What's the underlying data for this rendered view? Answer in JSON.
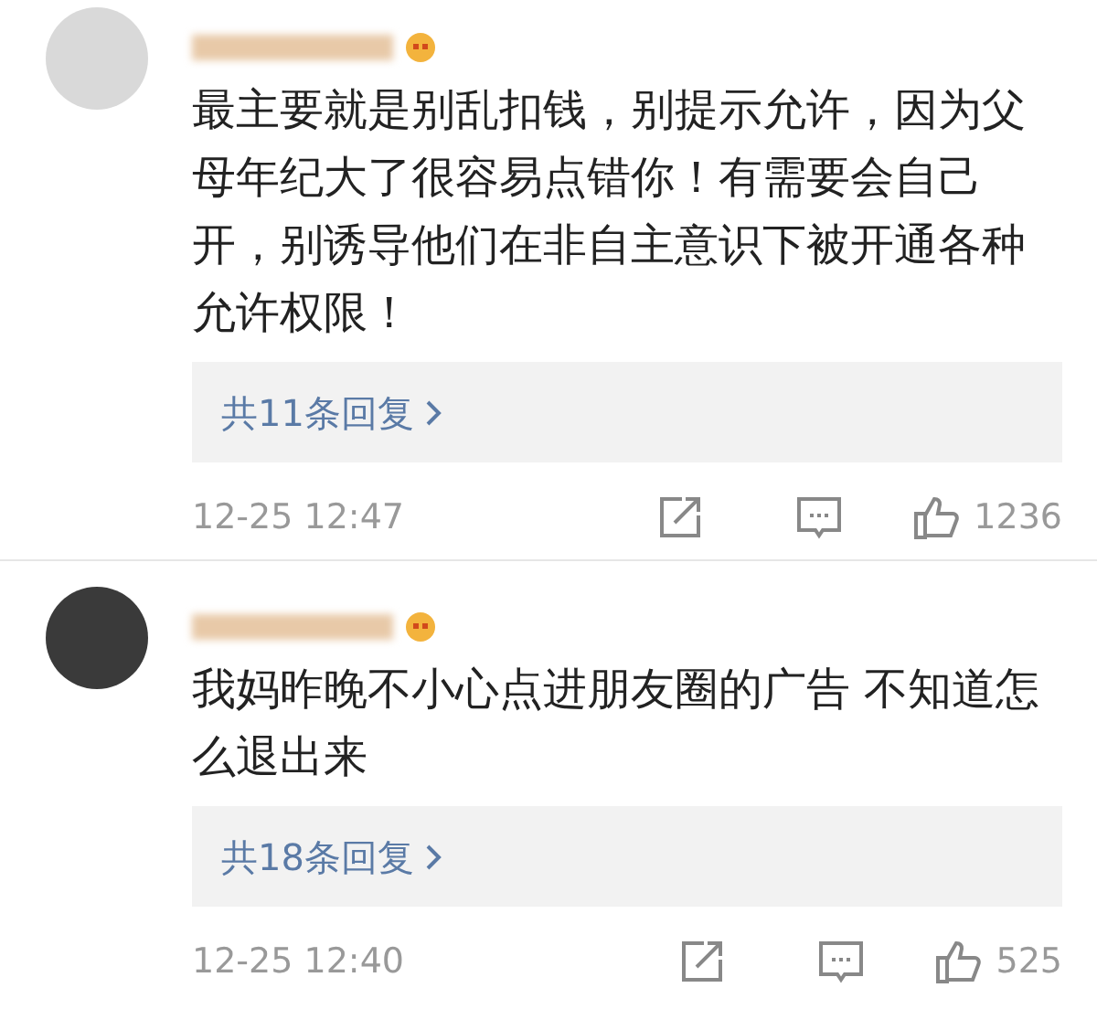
{
  "comments": [
    {
      "text": "最主要就是别乱扣钱，别提示允许，因为父母年纪大了很容易点错你！有需要会自己开，别诱导他们在非自主意识下被开通各种允许权限！",
      "replies": "共11条回复",
      "time": "12-25 12:47",
      "likes": "1236"
    },
    {
      "text": "我妈昨晚不小心点进朋友圈的广告 不知道怎么退出来",
      "replies": "共18条回复",
      "time": "12-25 12:40",
      "likes": "525"
    }
  ]
}
